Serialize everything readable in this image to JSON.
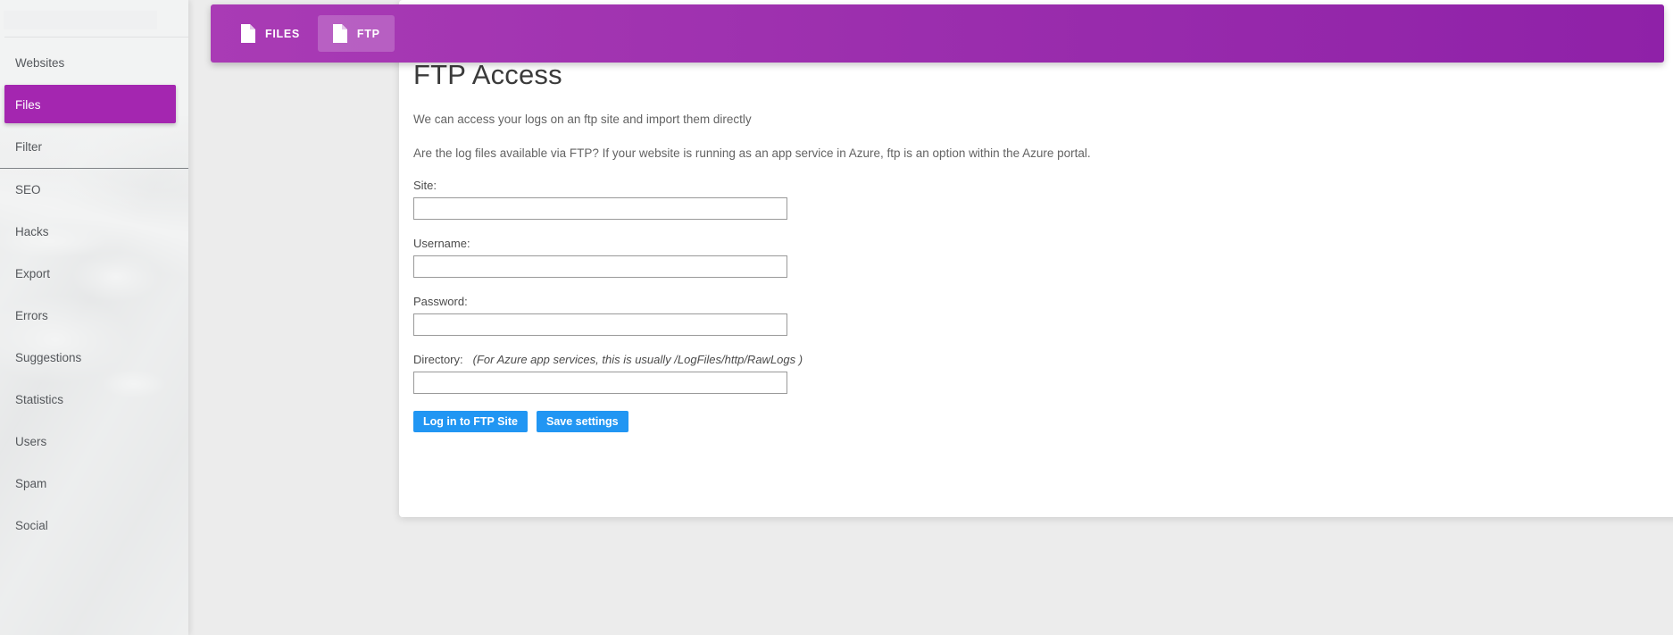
{
  "sidebar": {
    "search": {
      "value": "",
      "placeholder": ""
    },
    "items": [
      {
        "label": "Websites",
        "active": false,
        "separator_after": false
      },
      {
        "label": "Files",
        "active": true,
        "separator_after": false
      },
      {
        "label": "Filter",
        "active": false,
        "separator_after": true
      },
      {
        "label": "SEO",
        "active": false,
        "separator_after": false
      },
      {
        "label": "Hacks",
        "active": false,
        "separator_after": false
      },
      {
        "label": "Export",
        "active": false,
        "separator_after": false
      },
      {
        "label": "Errors",
        "active": false,
        "separator_after": false
      },
      {
        "label": "Suggestions",
        "active": false,
        "separator_after": false
      },
      {
        "label": "Statistics",
        "active": false,
        "separator_after": false
      },
      {
        "label": "Users",
        "active": false,
        "separator_after": false
      },
      {
        "label": "Spam",
        "active": false,
        "separator_after": false
      },
      {
        "label": "Social",
        "active": false,
        "separator_after": false
      }
    ]
  },
  "tabbar": {
    "accent_from": "#a93bb5",
    "accent_to": "#8f21a8",
    "tabs": [
      {
        "label": "FILES",
        "icon": "file-icon",
        "active": false
      },
      {
        "label": "FTP",
        "icon": "file-icon",
        "active": true
      }
    ]
  },
  "page": {
    "title": "FTP Access",
    "lead_1": "We can access your logs on an ftp site and import them directly",
    "lead_2": "Are the log files available via FTP? If your website is running as an app service in Azure, ftp is an option within the Azure portal."
  },
  "form": {
    "site": {
      "label": "Site:",
      "value": "",
      "placeholder": ""
    },
    "username": {
      "label": "Username:",
      "value": "",
      "placeholder": ""
    },
    "password": {
      "label": "Password:",
      "value": "",
      "placeholder": ""
    },
    "directory": {
      "label": "Directory:",
      "hint": "(For Azure app services, this is usually /LogFiles/http/RawLogs )",
      "value": "",
      "placeholder": ""
    },
    "buttons": {
      "login": "Log in to FTP Site",
      "save": "Save settings",
      "color": "#2196f3"
    }
  }
}
